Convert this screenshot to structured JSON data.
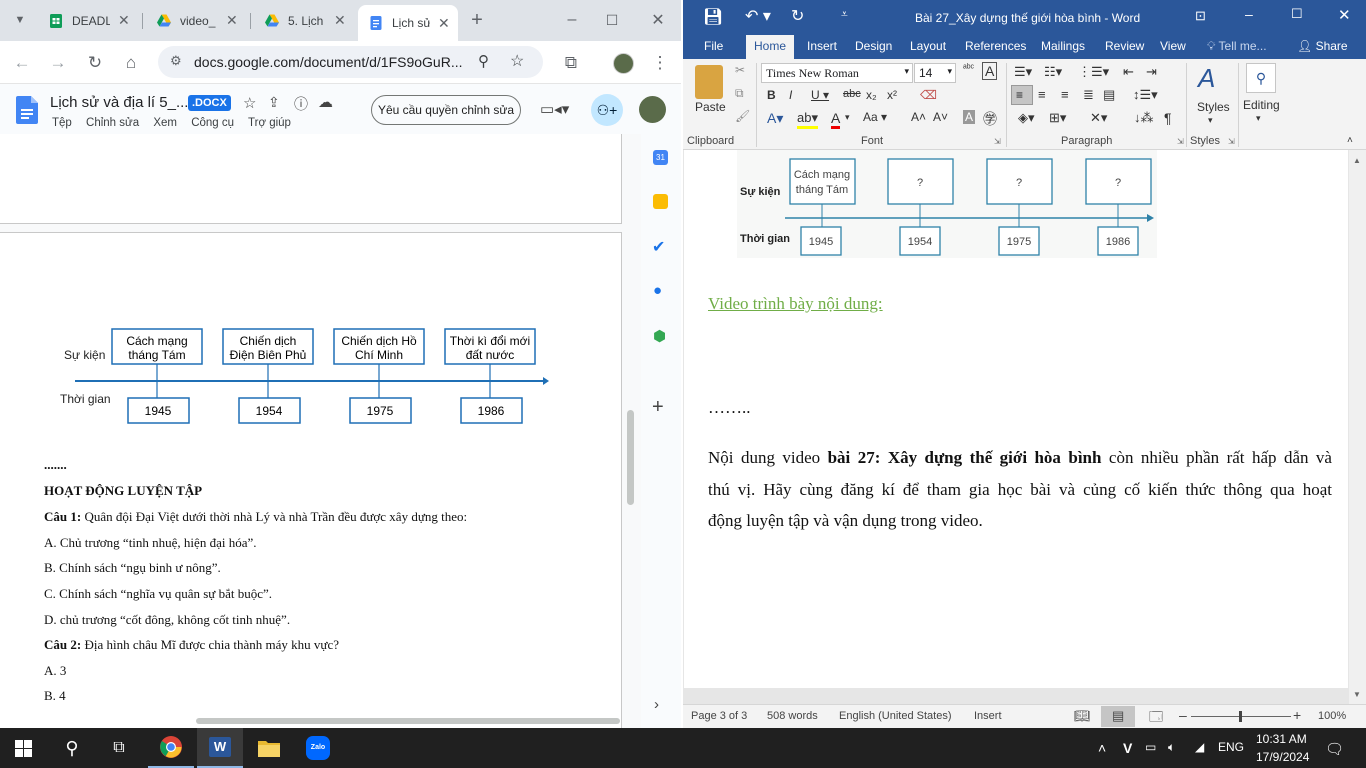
{
  "chrome": {
    "tabs": [
      {
        "title": "DEADL",
        "favicon": "sheets-icon"
      },
      {
        "title": "video_",
        "favicon": "drive-icon"
      },
      {
        "title": "5. Lịch",
        "favicon": "drive-icon"
      },
      {
        "title": "Lịch sử",
        "favicon": "docs-icon"
      }
    ],
    "url": "docs.google.com/document/d/1FS9oGuR...",
    "doc_title": "Lịch sử và địa lí 5_...",
    "doc_badge": ".DOCX",
    "menu": [
      "Tệp",
      "Chỉnh sửa",
      "Xem",
      "Công cụ",
      "Trợ giúp"
    ],
    "request_edit": "Yêu cầu quyền chỉnh sửa",
    "timeline": {
      "row_event": "Sự kiện",
      "row_time": "Thời gian",
      "events": [
        {
          "l1": "Cách mạng",
          "l2": "tháng Tám",
          "year": "1945"
        },
        {
          "l1": "Chiến dịch",
          "l2": "Điện Biên Phủ",
          "year": "1954"
        },
        {
          "l1": "Chiến dịch Hồ",
          "l2": "Chí Minh",
          "year": "1975"
        },
        {
          "l1": "Thời kì đổi mới",
          "l2": "đất nước",
          "year": "1986"
        }
      ]
    },
    "doc_lines": {
      "dots": ".......",
      "heading": "HOẠT ĐỘNG LUYỆN TẬP",
      "q1_label": "Câu 1:",
      "q1_text": "  Quân đội Đại Việt dưới thời nhà Lý và nhà Trần đều được xây dựng theo:",
      "a": "A. Chủ trương “tinh nhuệ, hiện đại hóa”.",
      "b": "B. Chính sách “ngụ binh ư nông”.",
      "c": "C. Chính sách “nghĩa vụ quân sự bắt buộc”.",
      "d": "D. chủ trương “cốt đông, không cốt tinh nhuệ”.",
      "q2_label": "Câu 2:",
      "q2_text": " Địa hình châu Mĩ được chia thành máy khu vực?",
      "q2a": "A. 3",
      "q2b": "B. 4"
    }
  },
  "word": {
    "title": "Bài 27_Xây dựng thế giới hòa bình - Word",
    "tabs": [
      "File",
      "Home",
      "Insert",
      "Design",
      "Layout",
      "References",
      "Mailings",
      "Review",
      "View"
    ],
    "tell_me": "Tell me...",
    "share": "Share",
    "font_name": "Times New Roman",
    "font_size": "14",
    "groups": [
      "Clipboard",
      "Font",
      "Paragraph",
      "Styles"
    ],
    "paste": "Paste",
    "styles": "Styles",
    "editing": "Editing",
    "timeline": {
      "row_event": "Sự kiện",
      "row_time": "Thời gian",
      "first_l1": "Cách mạng",
      "first_l2": "tháng Tám",
      "unknown": "?",
      "years": [
        "1945",
        "1954",
        "1975",
        "1986"
      ]
    },
    "video_heading": "Video trình bày nội dung:",
    "dots": "……..",
    "para_pre": "Nội dung video ",
    "para_bold": "bài 27: Xây dựng thế giới hòa bình",
    "para_post": " còn nhiều phần rất hấp dẫn và",
    "para_line2": "thú vị. Hãy cùng đăng kí để tham gia học bài và củng cố kiến thức thông qua hoạt",
    "para_line3": "động luyện tập và vận dụng trong video.",
    "status": {
      "page": "Page 3 of 3",
      "words": "508 words",
      "lang": "English (United States)",
      "mode": "Insert",
      "zoom": "100%"
    }
  },
  "taskbar": {
    "lang": "ENG",
    "time": "10:31 AM",
    "date": "17/9/2024",
    "zalo": "Zalo"
  }
}
